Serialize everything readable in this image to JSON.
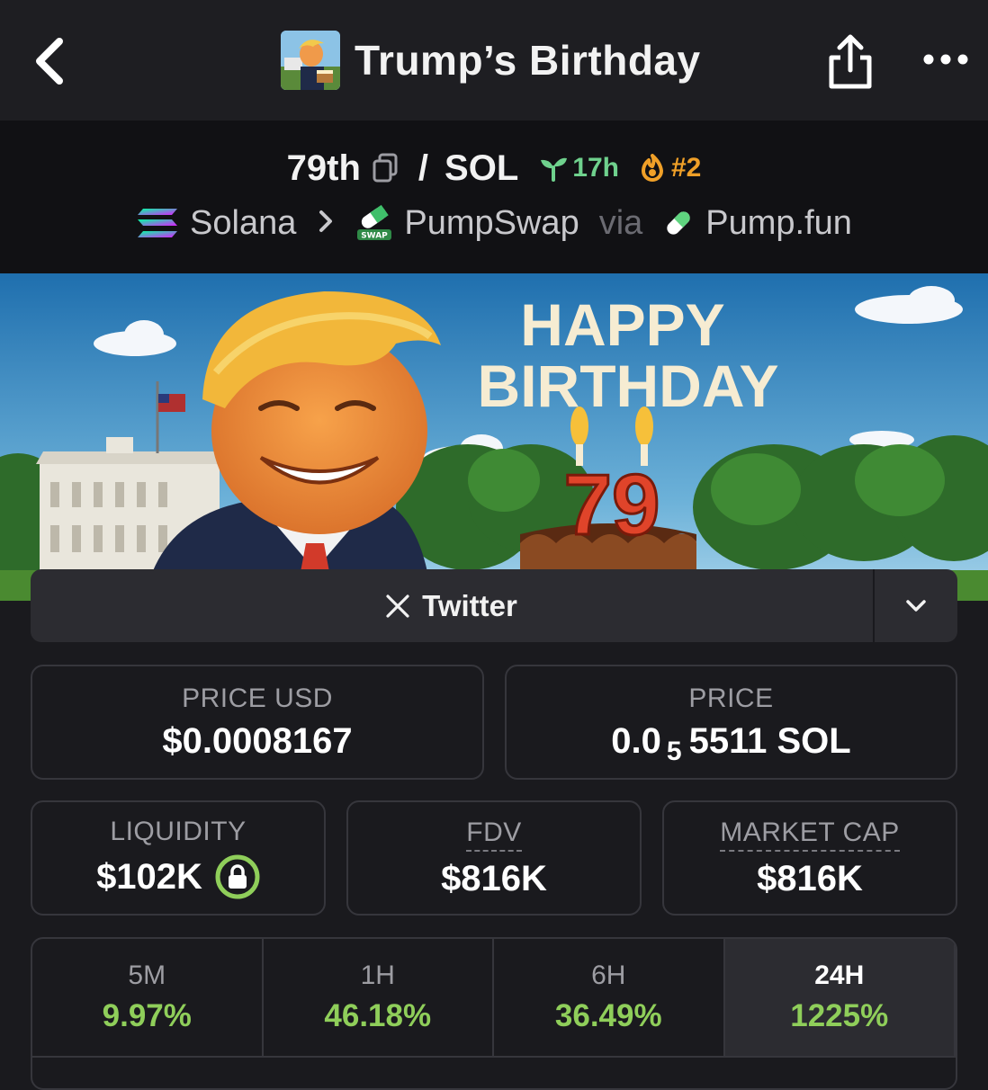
{
  "header": {
    "title": "Trump’s Birthday",
    "back_icon": "chevron-left-icon",
    "share_icon": "share-icon",
    "more_icon": "ellipsis-icon"
  },
  "pair": {
    "base": "79th",
    "separator": "/",
    "quote": "SOL",
    "age": "17h",
    "rank": "#2",
    "age_color": "#6fd18d",
    "rank_color": "#f0a028"
  },
  "route": {
    "chain": "Solana",
    "dex": "PumpSwap",
    "via": "via",
    "launchpad": "Pump.fun"
  },
  "banner": {
    "line1": "HAPPY",
    "line2": "BIRTHDAY",
    "cake_number": "79"
  },
  "social": {
    "twitter_label": "Twitter"
  },
  "stats": {
    "price_usd_label": "PRICE USD",
    "price_usd": "$0.0008167",
    "price_label": "PRICE",
    "price_prefix": "0.0",
    "price_zeros": "5",
    "price_suffix": "5511 SOL",
    "liquidity_label": "LIQUIDITY",
    "liquidity": "$102K",
    "fdv_label": "FDV",
    "fdv": "$816K",
    "mcap_label": "MARKET CAP",
    "mcap": "$816K"
  },
  "changes": [
    {
      "period": "5M",
      "value": "9.97%"
    },
    {
      "period": "1H",
      "value": "46.18%"
    },
    {
      "period": "6H",
      "value": "36.49%"
    },
    {
      "period": "24H",
      "value": "1225%"
    }
  ],
  "colors": {
    "positive": "#8fce5a",
    "background": "#1a1a1e",
    "card_border": "#36363c"
  }
}
